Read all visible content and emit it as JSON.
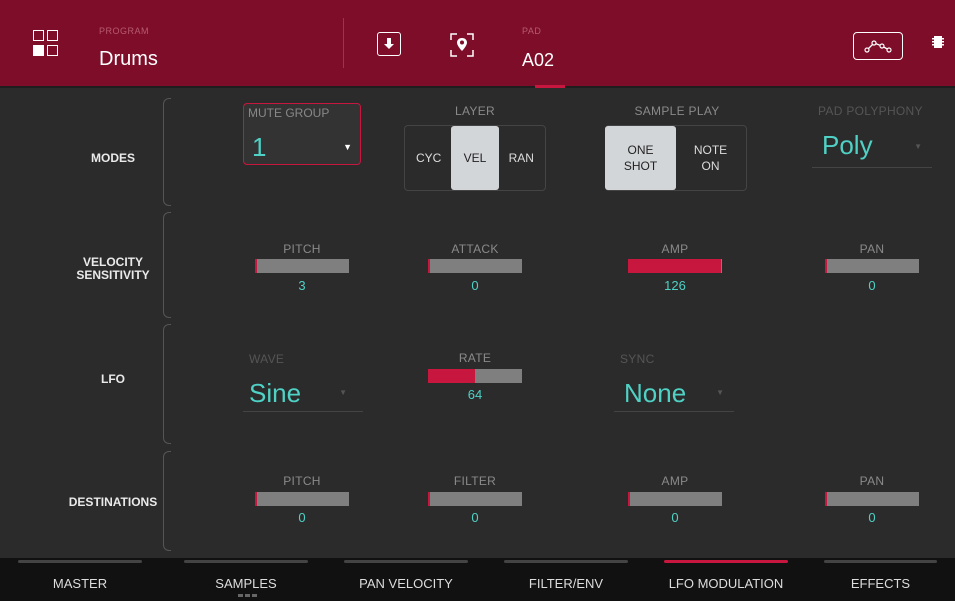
{
  "header": {
    "program_caption": "PROGRAM",
    "program_name": "Drums",
    "pad_caption": "PAD",
    "pad_value": "A02"
  },
  "rows": {
    "modes": "MODES",
    "velocity_1": "VELOCITY",
    "velocity_2": "SENSITIVITY",
    "lfo": "LFO",
    "destinations": "DESTINATIONS"
  },
  "modes": {
    "mute_group": {
      "label": "MUTE GROUP",
      "value": "1"
    },
    "layer": {
      "label": "LAYER",
      "options": [
        "CYC",
        "VEL",
        "RAN"
      ],
      "selected": "VEL"
    },
    "sample_play": {
      "label": "SAMPLE PLAY",
      "one_1": "ONE",
      "one_2": "SHOT",
      "note_1": "NOTE",
      "note_2": "ON",
      "selected": "ONE SHOT"
    },
    "pad_polyphony": {
      "label": "PAD POLYPHONY",
      "value": "Poly"
    }
  },
  "velocity": {
    "pitch": {
      "label": "PITCH",
      "value": "3",
      "fraction": 0.02
    },
    "attack": {
      "label": "ATTACK",
      "value": "0",
      "fraction": 0.0
    },
    "amp": {
      "label": "AMP",
      "value": "126",
      "fraction": 0.99
    },
    "pan": {
      "label": "PAN",
      "value": "0",
      "fraction": 0.0
    }
  },
  "lfo": {
    "wave": {
      "label": "WAVE",
      "value": "Sine"
    },
    "rate": {
      "label": "RATE",
      "value": "64",
      "fraction": 0.5
    },
    "sync": {
      "label": "SYNC",
      "value": "None"
    }
  },
  "destinations": {
    "pitch": {
      "label": "PITCH",
      "value": "0",
      "fraction": 0.0
    },
    "filter": {
      "label": "FILTER",
      "value": "0",
      "fraction": 0.0
    },
    "amp": {
      "label": "AMP",
      "value": "0",
      "fraction": 0.0
    },
    "pan": {
      "label": "PAN",
      "value": "0",
      "fraction": 0.0
    }
  },
  "tabs": [
    {
      "label": "MASTER"
    },
    {
      "label": "SAMPLES"
    },
    {
      "label": "PAN VELOCITY"
    },
    {
      "label": "FILTER/ENV"
    },
    {
      "label": "LFO MODULATION"
    },
    {
      "label": "EFFECTS"
    }
  ],
  "active_tab": "LFO MODULATION",
  "colors": {
    "header_bg": "#7d0d28",
    "accent": "#c8173e",
    "value_text": "#4fd1c5"
  },
  "icons": [
    "program-grid-icon",
    "download-icon",
    "location-icon",
    "envelope-icon",
    "chip-icon"
  ]
}
